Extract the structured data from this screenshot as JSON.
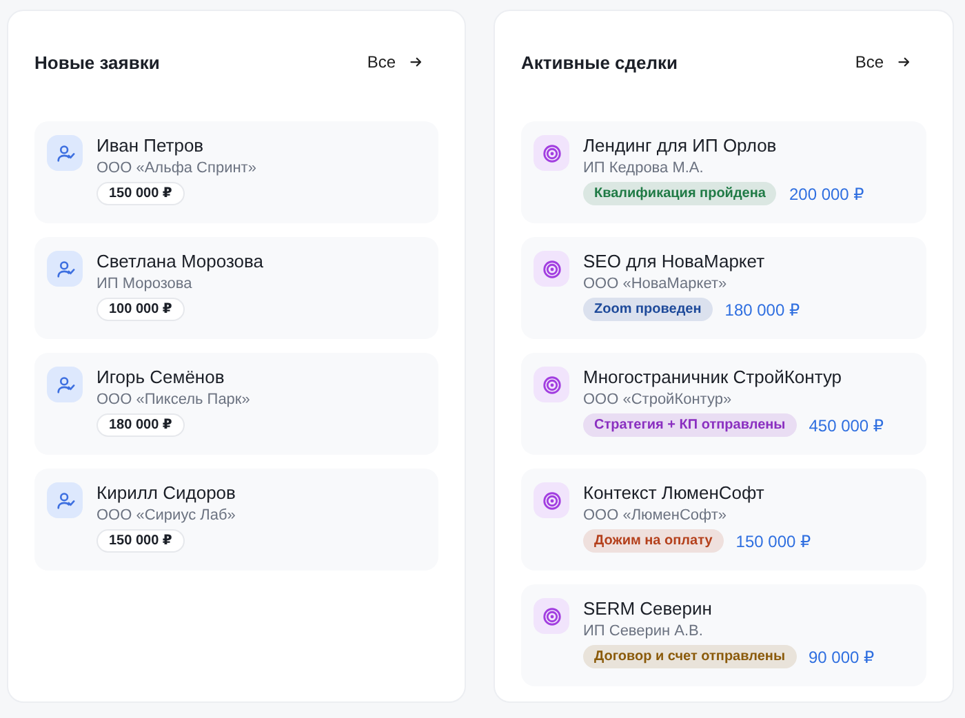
{
  "panels": [
    {
      "title": "Новые заявки",
      "link": "Все",
      "kind": "leads",
      "items": [
        {
          "name": "Иван Петров",
          "company": "ООО «Альфа Спринт»",
          "amount": "150 000 ₽"
        },
        {
          "name": "Светлана Морозова",
          "company": "ИП Морозова",
          "amount": "100 000 ₽"
        },
        {
          "name": "Игорь Семёнов",
          "company": "ООО «Пиксель Парк»",
          "amount": "180 000 ₽"
        },
        {
          "name": "Кирилл Сидоров",
          "company": "ООО «Сириус Лаб»",
          "amount": "150 000 ₽"
        }
      ]
    },
    {
      "title": "Активные сделки",
      "link": "Все",
      "kind": "deals",
      "items": [
        {
          "name": "Лендинг для ИП Орлов",
          "company": "ИП Кедрова М.А.",
          "stage": "Квалификация пройдена",
          "color": "#1f7a45",
          "amount": "200 000 ₽"
        },
        {
          "name": "SEO для НоваМаркет",
          "company": "ООО «НоваМаркет»",
          "stage": "Zoom проведен",
          "color": "#1e4a9a",
          "amount": "180 000 ₽"
        },
        {
          "name": "Многостраничник СтройКонтур",
          "company": "ООО «СтройКонтур»",
          "stage": "Стратегия + КП отправлены",
          "color": "#8a2fc0",
          "amount": "450 000 ₽"
        },
        {
          "name": "Контекст ЛюменСофт",
          "company": "ООО «ЛюменСофт»",
          "stage": "Дожим на оплату",
          "color": "#b4401c",
          "amount": "150 000 ₽"
        },
        {
          "name": "SERM Северин",
          "company": "ИП Северин А.В.",
          "stage": "Договор и счет отправлены",
          "color": "#8a5a0a",
          "amount": "90 000 ₽"
        }
      ]
    }
  ]
}
